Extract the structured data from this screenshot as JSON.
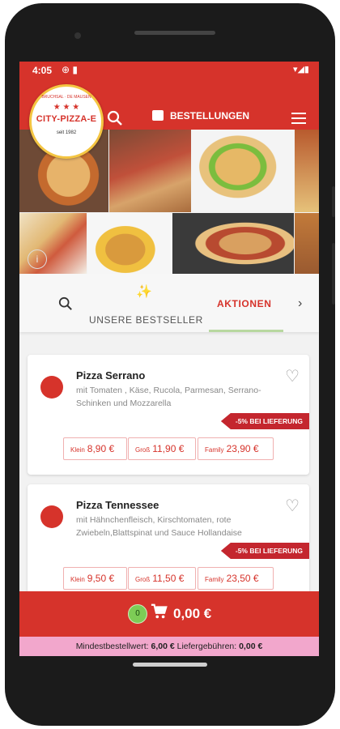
{
  "status_bar": {
    "time": "4:05",
    "left_icons": "⊕ ▮",
    "right_icons": "▾◢▮"
  },
  "header": {
    "logo": {
      "top_text": "BRUCHSAL · DE MAUSEN",
      "brand": "CITY-PIZZA-E",
      "since": "seit 1982"
    },
    "orders_label": "BESTELLUNGEN"
  },
  "tabs": {
    "bestseller_label": "UNSERE BESTSELLER",
    "aktionen_label": "AKTIONEN"
  },
  "products": [
    {
      "name": "Pizza Serrano",
      "description": "mit Tomaten , Käse, Rucola, Parmesan, Serrano-Schinken und Mozzarella",
      "discount": "-5% BEI LIEFERUNG",
      "prices": [
        {
          "size": "Klein",
          "price": "8,90 €"
        },
        {
          "size": "Groß",
          "price": "11,90 €"
        },
        {
          "size": "Family",
          "price": "23,90 €"
        }
      ]
    },
    {
      "name": "Pizza Tennessee",
      "description": "mit Hähnchenfleisch, Kirschtomaten, rote Zwiebeln,Blattspinat und Sauce Hollandaise",
      "discount": "-5% BEI LIEFERUNG",
      "prices": [
        {
          "size": "Klein",
          "price": "9,50 €"
        },
        {
          "size": "Groß",
          "price": "11,50 €"
        },
        {
          "size": "Family",
          "price": "23,50 €"
        }
      ]
    }
  ],
  "cart": {
    "count": "0",
    "total": "0,00 €"
  },
  "info": {
    "min_label": "Mindestbestellwert:",
    "min_value": "6,00 €",
    "fee_label": "Liefergebühren:",
    "fee_value": "0,00 €"
  },
  "colors": {
    "brand_red": "#d6332b",
    "info_pink": "#f2a7cc",
    "badge_green": "#7dcc56"
  },
  "icons": [
    "search-icon",
    "shopping-bag-icon",
    "menu-icon",
    "info-icon",
    "sparkle-icon",
    "chevron-right-icon",
    "heart-icon",
    "cart-icon"
  ]
}
